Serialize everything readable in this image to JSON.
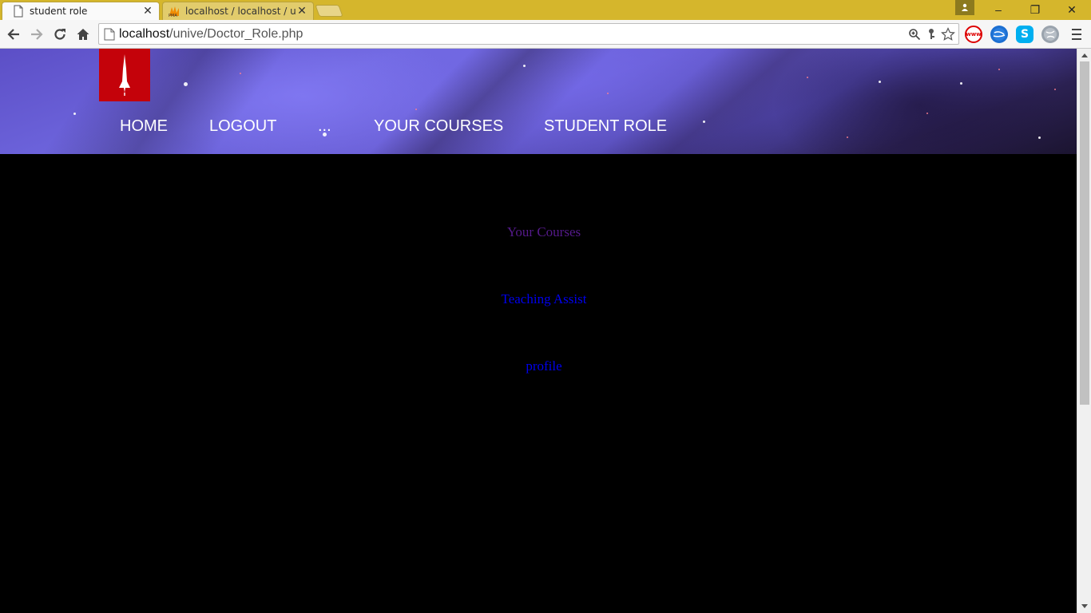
{
  "browser": {
    "tabs": [
      {
        "title": "student role",
        "active": true
      },
      {
        "title": "localhost / localhost / uni",
        "active": false
      }
    ],
    "address": {
      "host": "localhost",
      "path": "/unive/Doctor_Role.php"
    },
    "window_controls": {
      "minimize": "–",
      "restore": "❐",
      "close": "✕"
    },
    "extensions": [
      "www-blocker-icon",
      "earth-icon",
      "skype-icon",
      "globe-icon"
    ]
  },
  "site": {
    "nav": [
      {
        "label": "HOME"
      },
      {
        "label": "LOGOUT"
      },
      {
        "label": "..."
      },
      {
        "label": "YOUR COURSES"
      },
      {
        "label": "STUDENT ROLE"
      }
    ],
    "colors": {
      "logo_bg": "#c4020a",
      "visited_link": "#551a8b",
      "link": "#0000ee",
      "page_bg": "#000000"
    }
  },
  "main": {
    "links": [
      {
        "label": "Your Courses",
        "visited": true
      },
      {
        "label": "Teaching Assist",
        "visited": false
      },
      {
        "label": "profile",
        "visited": false
      }
    ]
  }
}
